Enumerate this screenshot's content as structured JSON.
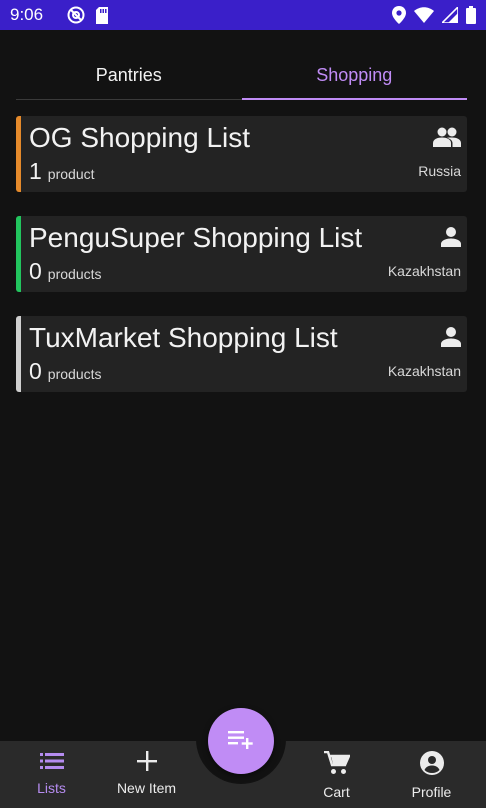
{
  "status_bar": {
    "time": "9:06",
    "icons_left": [
      "do-not-disturb-icon",
      "sd-card-icon"
    ],
    "icons_right": [
      "location-icon",
      "wifi-icon",
      "signal-icon",
      "battery-icon"
    ],
    "background": "#3a1fc9"
  },
  "tabs": [
    {
      "label": "Pantries",
      "active": false
    },
    {
      "label": "Shopping",
      "active": true
    }
  ],
  "lists": [
    {
      "title": "OG Shopping List",
      "count": "1",
      "count_label": "product",
      "country": "Russia",
      "accent": "#e58a2b",
      "icon": "group-icon"
    },
    {
      "title": "PenguSuper Shopping List",
      "count": "0",
      "count_label": "products",
      "country": "Kazakhstan",
      "accent": "#22c55e",
      "icon": "person-icon"
    },
    {
      "title": "TuxMarket Shopping List",
      "count": "0",
      "count_label": "products",
      "country": "Kazakhstan",
      "accent": "#cfcfcf",
      "icon": "person-icon"
    }
  ],
  "bottom_nav": {
    "items": [
      {
        "label": "Lists",
        "icon": "list-icon",
        "active": true
      },
      {
        "label": "New Item",
        "icon": "plus-icon",
        "active": false
      },
      {
        "label": "Cart",
        "icon": "cart-icon",
        "active": false
      },
      {
        "label": "Profile",
        "icon": "account-circle-icon",
        "active": false
      }
    ],
    "fab_icon": "playlist-add-icon"
  },
  "colors": {
    "accent": "#c08cf5",
    "background": "#121212",
    "card": "#232323",
    "nav": "#2a2a2a"
  }
}
